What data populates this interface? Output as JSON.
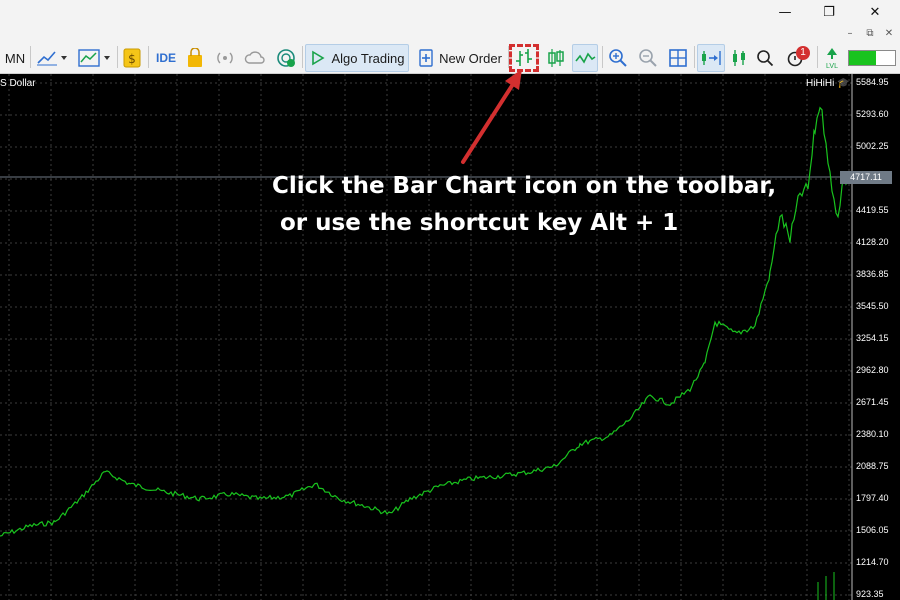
{
  "window": {
    "minimize_glyph": "—",
    "restore_glyph": "❐",
    "close_glyph": "✕",
    "mdi_minimize_glyph": "–",
    "mdi_restore_glyph": "⧉",
    "mdi_close_glyph": "✕"
  },
  "toolbar": {
    "timeframe_label": "MN",
    "ide_label": "IDE",
    "algo_trading_label": "Algo Trading",
    "new_order_label": "New Order",
    "notification_count": "1",
    "colors": {
      "accent_green": "#19a34a",
      "highlight_red": "#d32f2f",
      "icon_blue": "#2f6fd0"
    },
    "icons": [
      "line-chart-icon",
      "indicators-icon",
      "dollar-icon",
      "market-icon",
      "signals-icon",
      "cloud-icon",
      "vps-icon",
      "play-icon",
      "new-order-icon",
      "bar-chart-icon",
      "candlestick-icon",
      "line-mode-icon",
      "zoom-in-icon",
      "zoom-out-icon",
      "tile-icon",
      "autoscroll-icon",
      "chart-shift-icon",
      "search-icon",
      "notifications-icon",
      "lvl-icon"
    ]
  },
  "chart": {
    "symbol_label": "S Dollar",
    "trade_info": "HiHiHi",
    "current_price": "4717.11",
    "price_labels": [
      "5584.95",
      "5293.60",
      "5002.25",
      "4419.55",
      "4128.20",
      "3836.85",
      "3545.50",
      "3254.15",
      "2962.80",
      "2671.45",
      "2380.10",
      "2088.75",
      "1797.40",
      "1506.05",
      "1214.70",
      "923.35"
    ],
    "line_color": "#19c31e"
  },
  "annotation": {
    "line1": "Click the Bar Chart icon on the toolbar,",
    "line2": "or use the shortcut key Alt + 1"
  }
}
